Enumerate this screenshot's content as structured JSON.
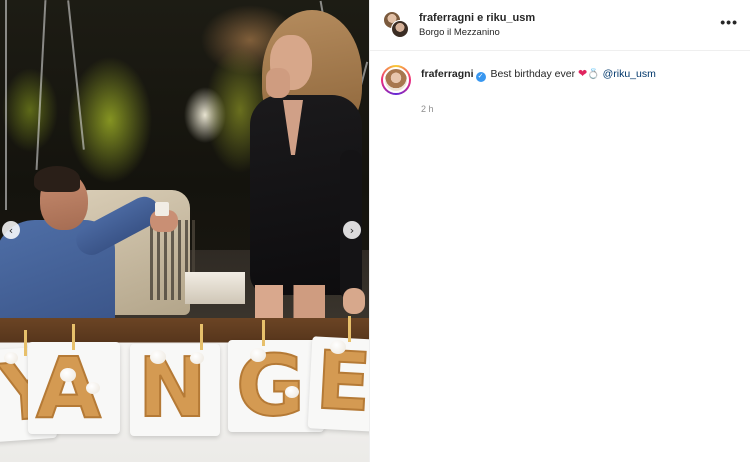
{
  "header": {
    "users": "fraferragni e riku_usm",
    "location": "Borgo il Mezzanino",
    "more_label": "•••"
  },
  "caption": {
    "username": "fraferragni",
    "verified_mark": "✓",
    "text": "Best birthday ever",
    "heart_emoji": "❤",
    "ring_emoji": "💍",
    "mention": "@riku_usm"
  },
  "timestamp": "2 h",
  "carousel": {
    "prev_label": "‹",
    "next_label": "›"
  },
  "photo": {
    "cake_letters": [
      "Y",
      "A",
      "N",
      "G",
      "E"
    ]
  },
  "colors": {
    "verified": "#3897f0",
    "heart": "#e0245e",
    "mention": "#00376b",
    "divider": "#efefef"
  },
  "icons": [
    "chevron-left-icon",
    "chevron-right-icon",
    "more-icon",
    "verified-icon"
  ]
}
